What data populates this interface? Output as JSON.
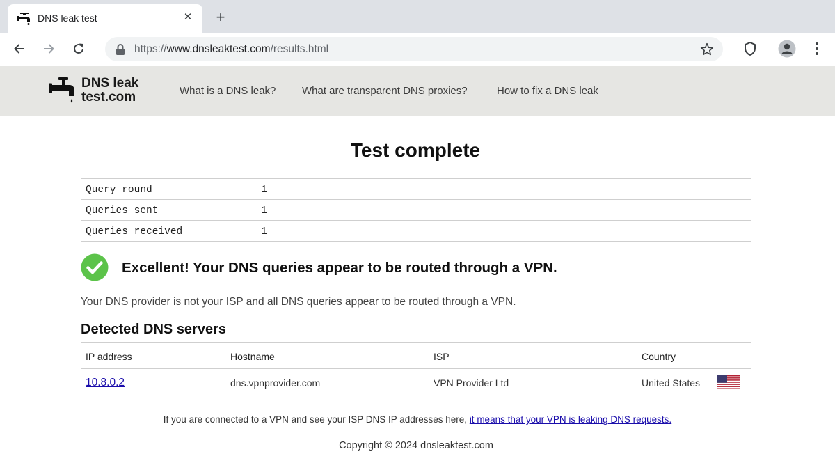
{
  "browser": {
    "tab_title": "DNS leak test",
    "close_tab_glyph": "✕",
    "new_tab_glyph": "+",
    "url_scheme": "https://",
    "url_host": "www.dnsleaktest.com",
    "url_path": "/results.html",
    "icons": [
      "tap-favicon-icon",
      "back-arrow-icon",
      "forward-arrow-icon",
      "reload-icon",
      "lock-icon",
      "bookmark-star-icon",
      "shield-extension-icon",
      "profile-avatar-icon",
      "kebab-menu-icon"
    ]
  },
  "site": {
    "logo_line1": "DNS leak",
    "logo_line2": "test.com",
    "nav": [
      {
        "label": "What is a DNS leak?"
      },
      {
        "label": "What are transparent DNS proxies?"
      },
      {
        "label": "How to fix a DNS leak"
      }
    ]
  },
  "main": {
    "title": "Test complete",
    "stats": [
      {
        "label": "Query round",
        "value": "1"
      },
      {
        "label": "Queries sent",
        "value": "1"
      },
      {
        "label": "Queries received",
        "value": "1"
      }
    ],
    "result_heading": "Excellent! Your DNS queries appear to be routed through a VPN.",
    "result_description": "Your DNS provider is not your ISP and all DNS queries appear to be routed through a VPN.",
    "result_status_color": "#5cc34a",
    "servers_title": "Detected DNS servers",
    "servers_columns": [
      "IP address",
      "Hostname",
      "ISP",
      "Country"
    ],
    "servers": [
      {
        "ip": "10.8.0.2",
        "hostname": "dns.vpnprovider.com",
        "isp": "VPN Provider Ltd",
        "country": "United States",
        "flag": "us-flag-icon"
      }
    ]
  },
  "footer": {
    "note_text": "If you are connected to a VPN and see your ISP DNS IP addresses here, ",
    "note_link": "it means that your VPN is leaking DNS requests.",
    "copyright": "Copyright © 2024 dnsleaktest.com"
  }
}
